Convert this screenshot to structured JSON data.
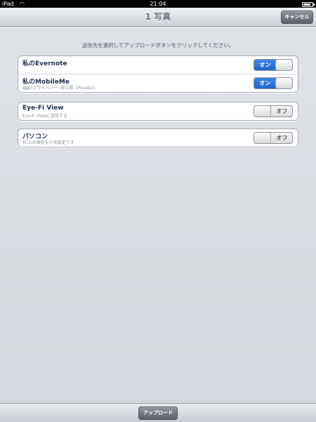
{
  "status_bar": {
    "device": "iPad",
    "time": "21:04"
  },
  "nav_bar": {
    "title": "1 写真",
    "cancel_label": "キャンセル"
  },
  "instruction": "送信先を選択してアップロードボタンをクリックしてください。",
  "groups": [
    {
      "rows": [
        {
          "label": "私のEvernote",
          "subtitle": "",
          "toggle": "オン",
          "state": "on"
        },
        {
          "label": "私のMobileMe",
          "subtitle": "(プライバシー: 非公開（Private))",
          "toggle": "オン",
          "state": "on"
        }
      ]
    },
    {
      "rows": [
        {
          "label": "Eye-Fi View",
          "subtitle": "Eye-Fi Viewに送信する",
          "toggle": "オフ",
          "state": "off"
        }
      ]
    },
    {
      "rows": [
        {
          "label": "パソコン",
          "subtitle": "PC上の保存先が未設定です",
          "toggle": "オフ",
          "state": "off"
        }
      ]
    }
  ],
  "toolbar": {
    "upload_label": "アップロード"
  }
}
